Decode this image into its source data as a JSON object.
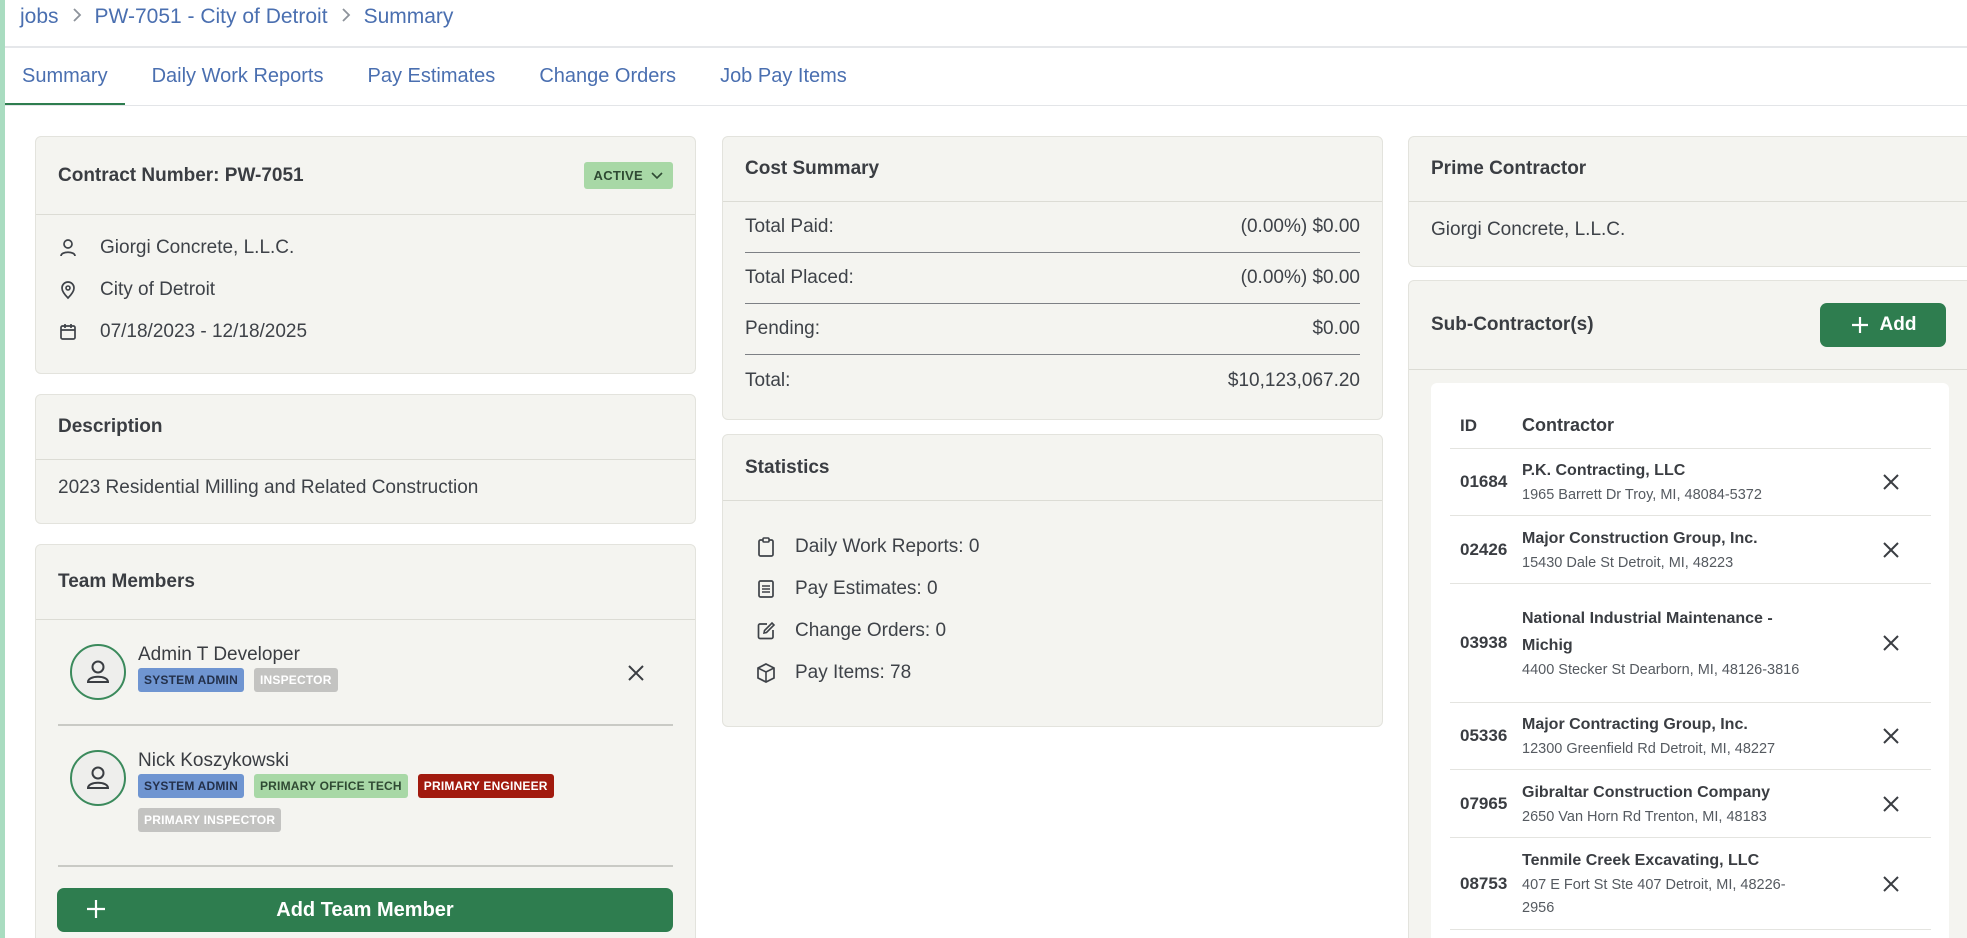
{
  "breadcrumb": [
    "jobs",
    "PW-7051 - City of Detroit",
    "Summary"
  ],
  "tabs": [
    "Summary",
    "Daily Work Reports",
    "Pay Estimates",
    "Change Orders",
    "Job Pay Items"
  ],
  "contract": {
    "title": "Contract Number: PW-7051",
    "status": "ACTIVE",
    "contractor": "Giorgi Concrete, L.L.C.",
    "location": "City of Detroit",
    "dates": "07/18/2023 - 12/18/2025"
  },
  "description": {
    "title": "Description",
    "text": "2023 Residential Milling and Related Construction"
  },
  "team": {
    "title": "Team Members",
    "add_label": "Add Team Member",
    "members": [
      {
        "name": "Admin T Developer",
        "roles": [
          "SYSTEM ADMIN",
          "INSPECTOR"
        ]
      },
      {
        "name": "Nick Koszykowski",
        "roles": [
          "SYSTEM ADMIN",
          "PRIMARY OFFICE TECH",
          "PRIMARY ENGINEER",
          "PRIMARY INSPECTOR"
        ]
      }
    ]
  },
  "cost_summary": {
    "title": "Cost Summary",
    "rows": [
      {
        "label": "Total Paid:",
        "value": "(0.00%) $0.00"
      },
      {
        "label": "Total Placed:",
        "value": "(0.00%) $0.00"
      },
      {
        "label": "Pending:",
        "value": "$0.00"
      },
      {
        "label": "Total:",
        "value": "$10,123,067.20"
      }
    ]
  },
  "statistics": {
    "title": "Statistics",
    "items": [
      {
        "label": "Daily Work Reports: 0",
        "icon": "clipboard-icon"
      },
      {
        "label": "Pay Estimates: 0",
        "icon": "document-list-icon"
      },
      {
        "label": "Change Orders: 0",
        "icon": "edit-icon"
      },
      {
        "label": "Pay Items: 78",
        "icon": "box-icon"
      }
    ]
  },
  "prime": {
    "title": "Prime Contractor",
    "name": "Giorgi Concrete, L.L.C."
  },
  "subs": {
    "title": "Sub-Contractor(s)",
    "add_label": "Add",
    "col_id": "ID",
    "col_contractor": "Contractor",
    "rows": [
      {
        "id": "01684",
        "name": "P.K. Contracting, LLC",
        "addr": "1965 Barrett Dr Troy, MI, 48084-5372"
      },
      {
        "id": "02426",
        "name": "Major Construction Group, Inc.",
        "addr": "15430 Dale St Detroit, MI, 48223"
      },
      {
        "id": "03938",
        "name": "National Industrial Maintenance - Michig",
        "addr": "4400 Stecker St Dearborn, MI, 48126-3816"
      },
      {
        "id": "05336",
        "name": "Major Contracting Group, Inc.",
        "addr": "12300 Greenfield Rd Detroit, MI, 48227"
      },
      {
        "id": "07965",
        "name": "Gibraltar Construction Company",
        "addr": "2650 Van Horn Rd Trenton, MI, 48183"
      },
      {
        "id": "08753",
        "name": "Tenmile Creek Excavating, LLC",
        "addr": "407 E Fort St Ste 407 Detroit, MI, 48226-2956"
      }
    ]
  }
}
